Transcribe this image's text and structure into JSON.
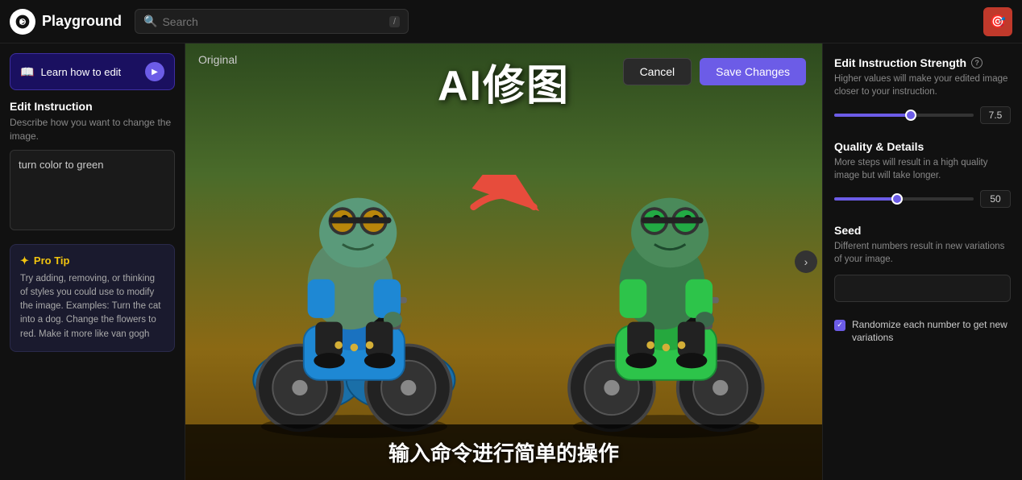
{
  "topbar": {
    "logo": "Playground",
    "search_placeholder": "Search",
    "search_shortcut": "/",
    "avatar_emoji": "🎯"
  },
  "left_sidebar": {
    "learn_btn_label": "Learn how to edit",
    "edit_instruction_title": "Edit Instruction",
    "edit_instruction_desc": "Describe how you want to change the image.",
    "instruction_value": "turn color to green",
    "pro_tip_title": "Pro Tip",
    "pro_tip_text": "Try adding, removing, or thinking of styles you could use to modify the image. Examples: Turn the cat into a dog. Change the flowers to red. Make it more like van gogh"
  },
  "center": {
    "title_cn": "AI修图",
    "cancel_label": "Cancel",
    "save_label": "Save Changes",
    "original_label": "Original",
    "subtitle_cn": "输入命令进行简单的操作"
  },
  "right_sidebar": {
    "strength_title": "Edit Instruction Strength",
    "strength_desc": "Higher values will make your edited image closer to your instruction.",
    "strength_value": "7.5",
    "strength_pct": 55,
    "quality_title": "Quality & Details",
    "quality_desc": "More steps will result in a high quality image but will take longer.",
    "quality_value": "50",
    "quality_pct": 45,
    "seed_title": "Seed",
    "seed_desc": "Different numbers result in new variations of your image.",
    "seed_value": "",
    "randomize_label": "Randomize each number to get new variations"
  }
}
